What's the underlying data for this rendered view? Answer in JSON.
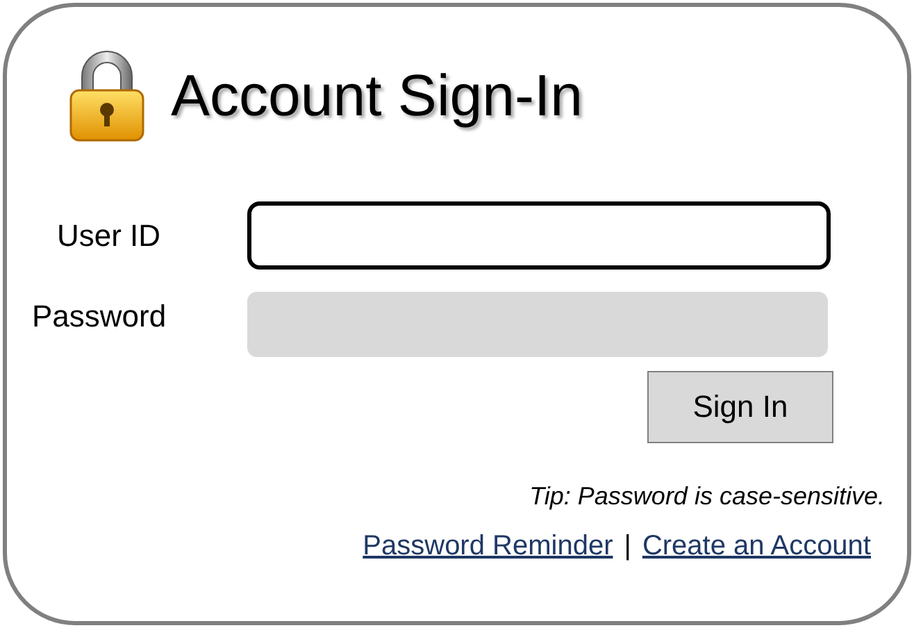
{
  "title": "Account Sign-In",
  "fields": [
    {
      "label": "User ID",
      "focused": true
    },
    {
      "label": "Password",
      "focused": false
    }
  ],
  "button": "Sign In",
  "tip": "Tip: Password is case-sensitive.",
  "links": [
    "Password Reminder",
    "Create an Account"
  ],
  "separator": "|"
}
